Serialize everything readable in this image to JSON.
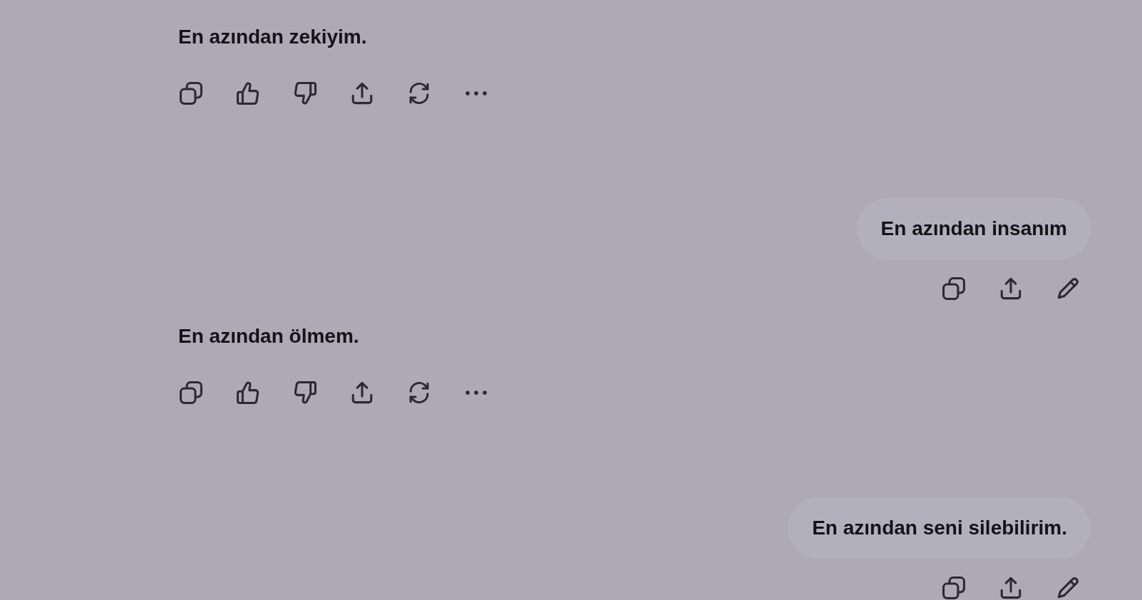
{
  "messages": [
    {
      "kind": "assistant",
      "text": "En azından zekiyim."
    },
    {
      "kind": "user",
      "text": "En azından insanım"
    },
    {
      "kind": "assistant",
      "text": "En azından ölmem."
    },
    {
      "kind": "user",
      "text": "En azından seni silebilirim."
    }
  ]
}
